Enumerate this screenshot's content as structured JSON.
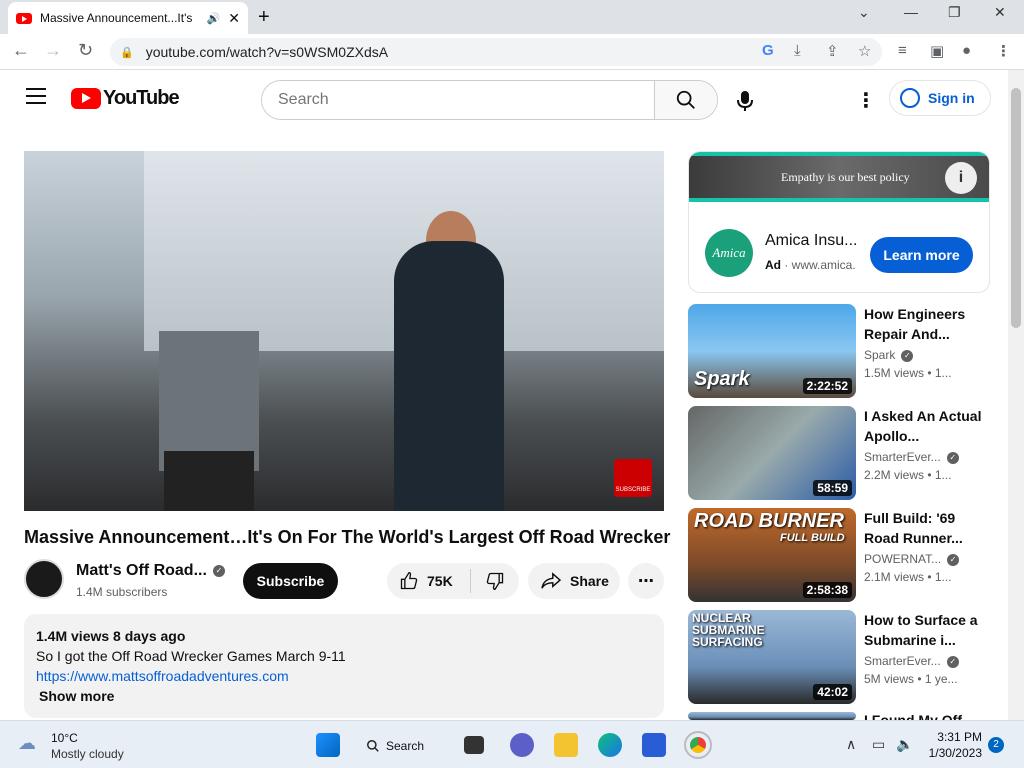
{
  "browser": {
    "tab_title": "Massive Announcement...It's",
    "url": "youtube.com/watch?v=s0WSM0ZXdsA"
  },
  "header": {
    "logo_text": "YouTube",
    "search_placeholder": "Search",
    "signin_label": "Sign in"
  },
  "video": {
    "title": "Massive Announcement…It's On For The World's Largest Off Road Wrecker",
    "channel_name": "Matt's Off Road...",
    "subscribers": "1.4M subscribers",
    "subscribe_label": "Subscribe",
    "likes": "75K",
    "share_label": "Share",
    "player_badge": "SUBSCRIBE"
  },
  "description": {
    "stats": "1.4M views  8 days ago",
    "line1": "So I got the Off Road Wrecker Games March 9-11",
    "link": "https://www.mattsoffroadadventures.com",
    "show_more": "Show more"
  },
  "ad": {
    "banner_text": "Empathy is our best policy",
    "brand_logo": "Amica",
    "name": "Amica Insu...",
    "ad_label": "Ad",
    "domain": "www.amica.",
    "cta": "Learn more"
  },
  "recommendations": [
    {
      "title": "How Engineers Repair And...",
      "channel": "Spark",
      "meta": "1.5M views  • 1...",
      "duration": "2:22:52",
      "thumb_label": "Spark"
    },
    {
      "title": "I Asked An Actual Apollo...",
      "channel": "SmarterEver...",
      "meta": "2.2M views  • 1...",
      "duration": "58:59",
      "thumb_label": ""
    },
    {
      "title": "Full Build: '69 Road Runner...",
      "channel": "POWERNAT...",
      "meta": "2.1M views  • 1...",
      "duration": "2:58:38",
      "thumb_label": "ROAD BURNER",
      "thumb_sub": "FULL BUILD"
    },
    {
      "title": "How to Surface a Submarine i...",
      "channel": "SmarterEver...",
      "meta": "5M views  • 1 ye...",
      "duration": "42:02",
      "thumb_label": "NUCLEAR SUBMARINE SURFACING"
    },
    {
      "title": "I Found My Off",
      "channel": "",
      "meta": "",
      "duration": "",
      "thumb_label": ""
    }
  ],
  "taskbar": {
    "temp": "10°C",
    "weather": "Mostly cloudy",
    "search_label": "Search",
    "time": "3:31 PM",
    "date": "1/30/2023",
    "notifications": "2"
  }
}
